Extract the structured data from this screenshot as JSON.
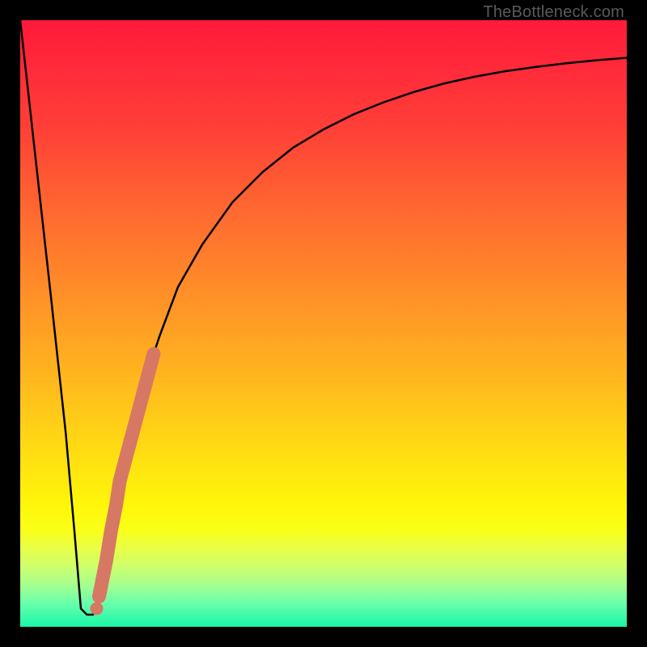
{
  "attribution": "TheBottleneck.com",
  "colors": {
    "frame": "#000000",
    "curve": "#000000",
    "marker": "#d77864",
    "gradient_stops": [
      "#ff1a3a",
      "#ff6a30",
      "#ffd316",
      "#fff60a",
      "#18f7a8"
    ]
  },
  "chart_data": {
    "type": "line",
    "title": "",
    "xlabel": "",
    "ylabel": "",
    "xlim": [
      0,
      100
    ],
    "ylim": [
      0,
      100
    ],
    "series": [
      {
        "name": "bottleneck-curve",
        "x": [
          0,
          5,
          7.5,
          9,
          10,
          11,
          12,
          13,
          14,
          15,
          17,
          20,
          23,
          26,
          30,
          35,
          40,
          45,
          50,
          55,
          60,
          65,
          70,
          75,
          80,
          85,
          90,
          95,
          100
        ],
        "y": [
          100,
          55,
          32,
          15,
          3,
          2,
          2,
          5,
          10,
          16,
          26,
          39,
          48,
          56,
          63,
          70,
          75,
          79,
          82,
          84.5,
          86.5,
          88.2,
          89.6,
          90.7,
          91.6,
          92.3,
          92.9,
          93.4,
          93.8
        ]
      }
    ],
    "markers": [
      {
        "name": "highlighted-segment",
        "color": "#d77864",
        "points": [
          {
            "x": 13.0,
            "y": 5
          },
          {
            "x": 13.6,
            "y": 8
          },
          {
            "x": 14.2,
            "y": 11
          },
          {
            "x": 15.0,
            "y": 16
          },
          {
            "x": 15.8,
            "y": 20
          },
          {
            "x": 16.4,
            "y": 24
          },
          {
            "x": 17.2,
            "y": 27
          },
          {
            "x": 18.0,
            "y": 30
          },
          {
            "x": 18.8,
            "y": 33
          },
          {
            "x": 19.6,
            "y": 36
          },
          {
            "x": 20.4,
            "y": 39
          },
          {
            "x": 21.2,
            "y": 42
          },
          {
            "x": 22.0,
            "y": 45
          }
        ]
      }
    ]
  }
}
